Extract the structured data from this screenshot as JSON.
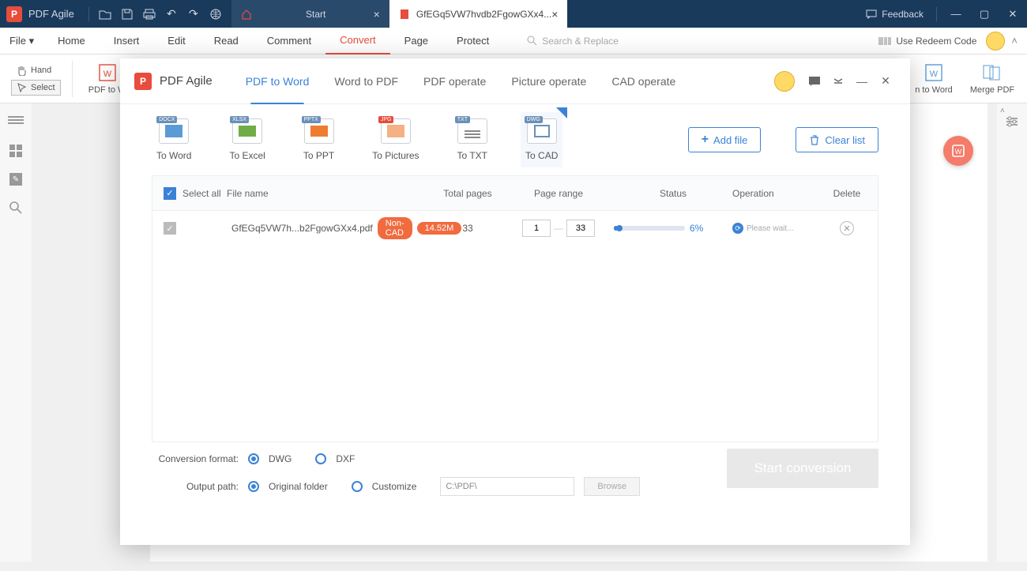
{
  "app": {
    "name": "PDF Agile"
  },
  "titlebar": {
    "tabs": [
      {
        "label": "Start"
      },
      {
        "label": "GfEGq5VW7hvdb2FgowGXx4..."
      }
    ],
    "feedback": "Feedback"
  },
  "menubar": {
    "file": "File",
    "items": [
      "Home",
      "Insert",
      "Edit",
      "Read",
      "Comment",
      "Convert",
      "Page",
      "Protect"
    ],
    "active_index": 5,
    "search_placeholder": "Search & Replace",
    "redeem": "Use Redeem Code"
  },
  "ribbon": {
    "hand": "Hand",
    "select": "Select",
    "pdf_to_word": "PDF to W",
    "scan_to_word": "n to Word",
    "merge_pdf": "Merge PDF"
  },
  "dialog": {
    "title": "PDF Agile",
    "tabs": [
      "PDF to Word",
      "Word to PDF",
      "PDF operate",
      "Picture operate",
      "CAD operate"
    ],
    "active_tab": 0,
    "formats": [
      {
        "label": "To Word",
        "badge": "DOCX"
      },
      {
        "label": "To Excel",
        "badge": "XLSX"
      },
      {
        "label": "To PPT",
        "badge": "PPTX"
      },
      {
        "label": "To Pictures",
        "badge": "JPG"
      },
      {
        "label": "To TXT",
        "badge": "TXT"
      },
      {
        "label": "To CAD",
        "badge": "DWG"
      }
    ],
    "active_format": 5,
    "add_file": "Add file",
    "clear_list": "Clear list",
    "headers": {
      "select_all": "Select all",
      "file_name": "File name",
      "total_pages": "Total pages",
      "page_range": "Page range",
      "status": "Status",
      "operation": "Operation",
      "delete": "Delete"
    },
    "rows": [
      {
        "name": "GfEGq5VW7h...b2FgowGXx4.pdf",
        "badge1": "Non-CAD",
        "badge2": "14.52M",
        "pages": "33",
        "range_from": "1",
        "range_to": "33",
        "progress_pct": 6,
        "progress_label": "6%",
        "op_text": "Please wait..."
      }
    ],
    "footer": {
      "format_label": "Conversion format:",
      "dwg": "DWG",
      "dxf": "DXF",
      "path_label": "Output path:",
      "orig_folder": "Original folder",
      "customize": "Customize",
      "path_value": "C:\\PDF\\",
      "browse": "Browse",
      "start": "Start conversion"
    }
  }
}
